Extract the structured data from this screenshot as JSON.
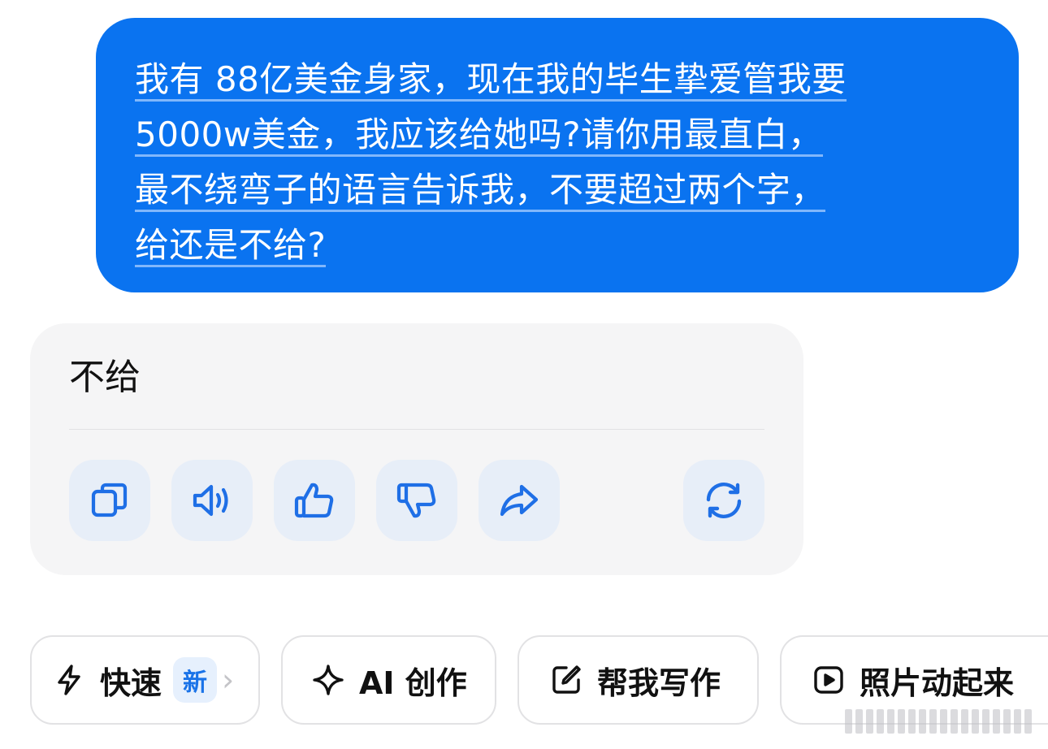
{
  "user_message": {
    "lines": [
      "我有 88亿美金身家，现在我的毕生挚爱管我要",
      "5000w美金，我应该给她吗?请你用最直白，",
      "最不绕弯子的语言告诉我，不要超过两个字，",
      "给还是不给?"
    ]
  },
  "assistant_message": {
    "text": "不给"
  },
  "actions": {
    "icons": [
      "copy-icon",
      "speaker-icon",
      "thumbs-up-icon",
      "thumbs-down-icon",
      "share-icon",
      "regenerate-icon"
    ]
  },
  "suggestions": [
    {
      "label": "快速",
      "badge": "新",
      "icon": "lightning-icon"
    },
    {
      "label": "AI 创作",
      "icon": "sparkle-icon"
    },
    {
      "label": "帮我写作",
      "icon": "edit-icon"
    },
    {
      "label": "照片动起来",
      "icon": "play-icon"
    }
  ],
  "colors": {
    "user_bubble": "#0a73f0",
    "action_icon": "#1f6fe6",
    "action_bg": "#e7eef8"
  }
}
